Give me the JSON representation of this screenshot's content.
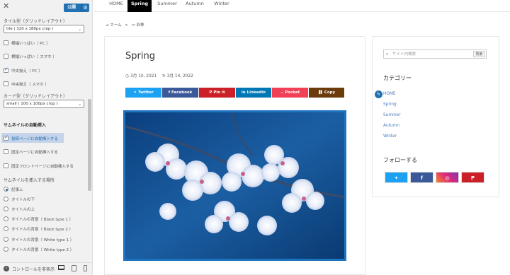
{
  "customizer": {
    "publish_label": "公開",
    "tile_type_label": "タイル型（グリッドレイアウト）",
    "tile_type_value": "tile ( 320 x 180px crop )",
    "tile_options": [
      {
        "label": "横幅いっぱい（ PC ）",
        "checked": false
      },
      {
        "label": "横幅いっぱい（ スマホ ）",
        "checked": false
      },
      {
        "label": "中央揃え（ PC ）",
        "checked": true
      },
      {
        "label": "中央揃え（ スマホ ）",
        "checked": false
      }
    ],
    "card_type_label": "カード型（グリッドレイアウト）",
    "card_type_value": "small ( 100 x 100px crop )",
    "thumb_section_title": "サムネイルの自動挿入",
    "auto_insert": [
      {
        "label": "投稿ページに自動挿入する",
        "checked": true
      },
      {
        "label": "固定ページに自動挿入する",
        "checked": false
      },
      {
        "label": "固定フロントページに自動挿入する",
        "checked": false
      }
    ],
    "position_label": "サムネイルを挿入する場所",
    "positions": [
      {
        "label": "記事上",
        "selected": true
      },
      {
        "label": "タイトルの下",
        "selected": false
      },
      {
        "label": "タイトルの上",
        "selected": false
      },
      {
        "label": "タイトルの背景（ Black type 1 ）",
        "selected": false
      },
      {
        "label": "タイトルの背景（ Black type 2 ）",
        "selected": false
      },
      {
        "label": "タイトルの背景（ White type 1 ）",
        "selected": false
      },
      {
        "label": "タイトルの背景（ White type 2 ）",
        "selected": false
      }
    ],
    "footer_label": "コントロールを非表示"
  },
  "nav": {
    "items": [
      {
        "label": "HOME",
        "active": false
      },
      {
        "label": "Spring",
        "active": true
      },
      {
        "label": "Summer",
        "active": false
      },
      {
        "label": "Autumn",
        "active": false
      },
      {
        "label": "Winter",
        "active": false
      }
    ]
  },
  "breadcrumb": {
    "home": "ホーム",
    "sep": ">",
    "category": "四季"
  },
  "post": {
    "title": "Spring",
    "published": "3月 10, 2021",
    "updated": "3月 14, 2022",
    "share_buttons": [
      {
        "label": "Twitter",
        "icon": "twitter-icon",
        "color": "#1da1f2"
      },
      {
        "label": "Facebook",
        "icon": "facebook-icon",
        "color": "#3b5998"
      },
      {
        "label": "Pin it",
        "icon": "pinterest-icon",
        "color": "#cb2027"
      },
      {
        "label": "LinkedIn",
        "icon": "linkedin-icon",
        "color": "#0077b5"
      },
      {
        "label": "Pocket",
        "icon": "pocket-icon",
        "color": "#ef4056"
      },
      {
        "label": "Copy",
        "icon": "link-icon",
        "color": "#6b3b0b"
      }
    ],
    "image_alt": "cherry-blossoms-photo"
  },
  "sidebar": {
    "search_placeholder": "サイト内検索",
    "search_button": "検索",
    "category_heading": "カテゴリー",
    "categories": [
      "HOME",
      "Spring",
      "Summer",
      "Autumn",
      "Winter"
    ],
    "follow_heading": "フォローする",
    "follow_buttons": [
      {
        "icon": "twitter-icon",
        "color": "#1da1f2"
      },
      {
        "icon": "facebook-icon",
        "color": "#3b5998"
      },
      {
        "icon": "instagram-icon",
        "color": "#dd2a7b"
      },
      {
        "icon": "pinterest-icon",
        "color": "#cb2027"
      }
    ]
  },
  "colors": {
    "accent": "#1e73be",
    "publish": "#2271b1"
  }
}
